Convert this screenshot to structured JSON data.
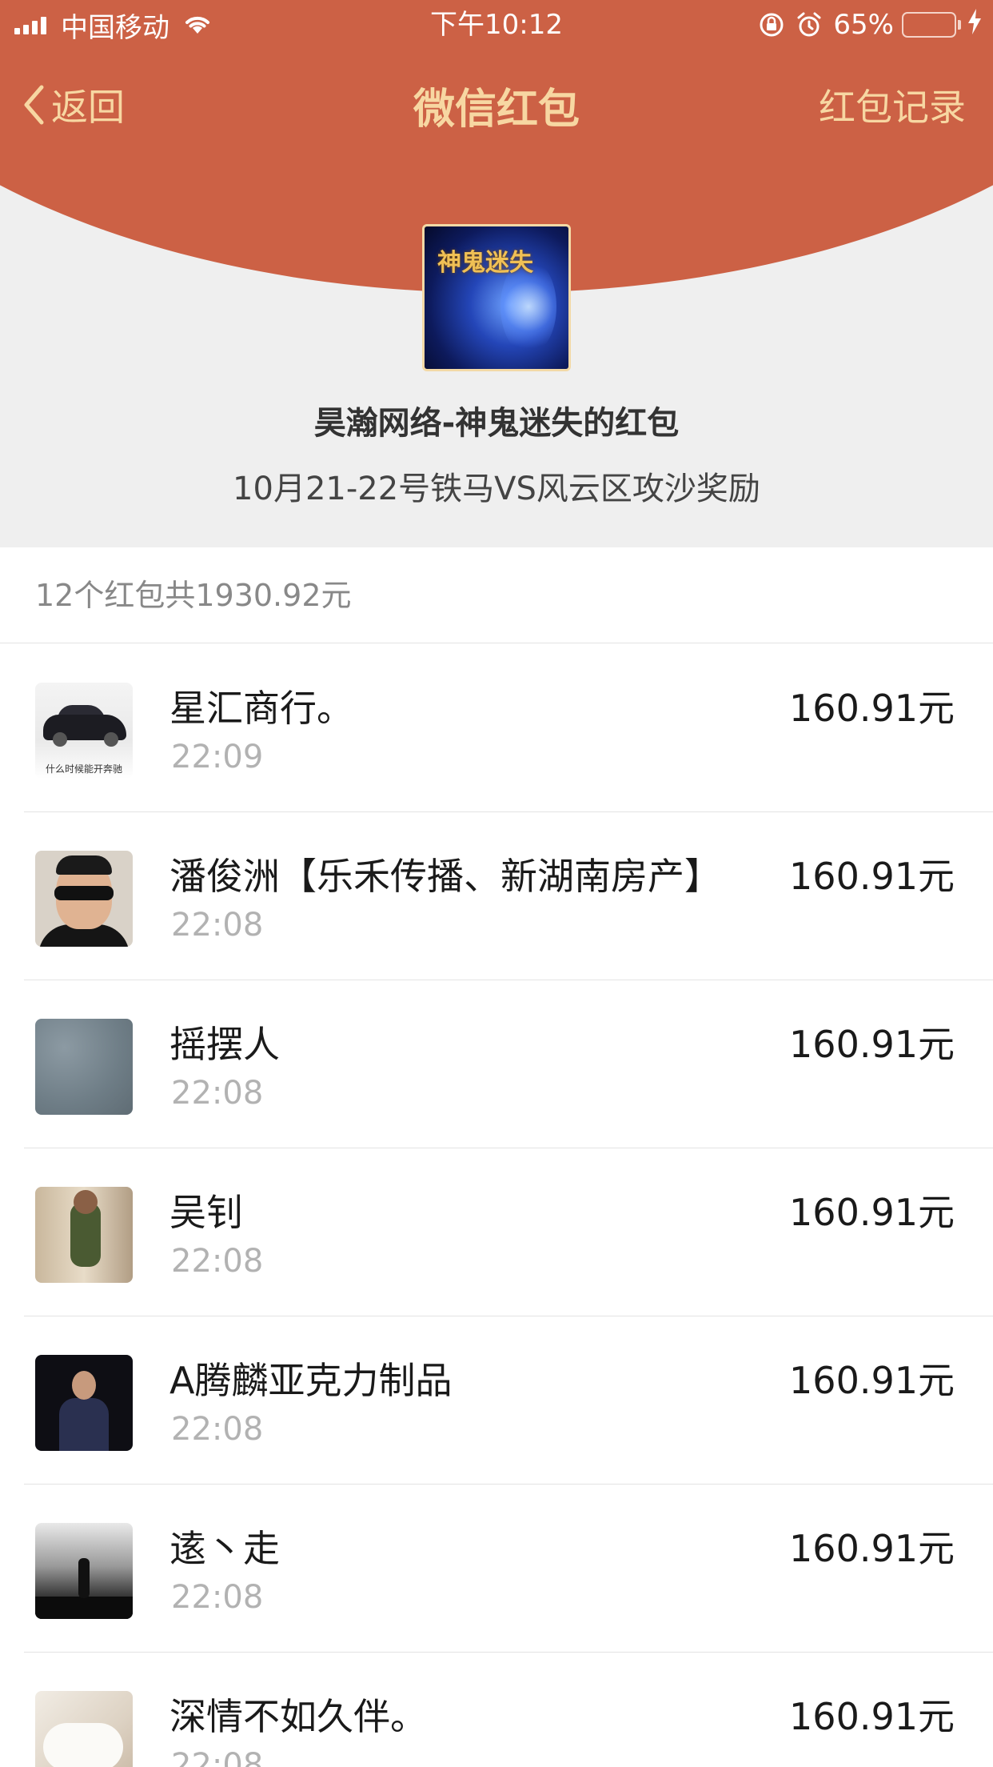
{
  "status_bar": {
    "carrier": "中国移动",
    "time": "下午10:12",
    "battery_text": "65%",
    "battery_level": 0.65
  },
  "nav": {
    "back_label": "返回",
    "title": "微信红包",
    "record_label": "红包记录"
  },
  "sender": {
    "name": "昊瀚网络-神鬼迷失的红包",
    "greeting": "10月21-22号铁马VS风云区攻沙奖励",
    "avatar_text": "神鬼迷失"
  },
  "summary": "12个红包共1930.92元",
  "recipients": [
    {
      "name": "星汇商行。",
      "time": "22:09",
      "amount": "160.91元",
      "avatar_caption": "什么时候能开奔驰"
    },
    {
      "name": "潘俊洲【乐禾传播、新湖南房产】",
      "time": "22:08",
      "amount": "160.91元"
    },
    {
      "name": "摇摆人",
      "time": "22:08",
      "amount": "160.91元"
    },
    {
      "name": "吴钊",
      "time": "22:08",
      "amount": "160.91元"
    },
    {
      "name": "A腾麟亚克力制品",
      "time": "22:08",
      "amount": "160.91元"
    },
    {
      "name": "逺丶走",
      "time": "22:08",
      "amount": "160.91元"
    },
    {
      "name": "深情不如久伴。",
      "time": "22:08",
      "amount": "160.91元"
    }
  ],
  "colors": {
    "banner_red": "#cc6145",
    "nav_gold": "#f7d7a2",
    "battery_green": "#7ed957"
  }
}
